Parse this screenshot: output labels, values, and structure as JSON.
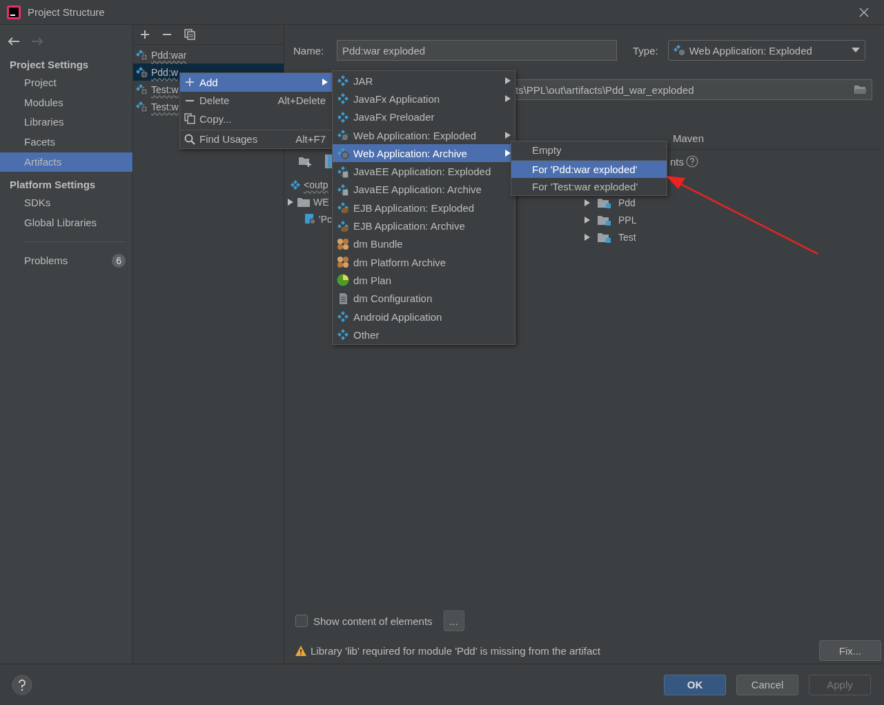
{
  "window": {
    "title": "Project Structure"
  },
  "sidebar": {
    "sections": [
      {
        "title": "Project Settings",
        "items": [
          {
            "label": "Project",
            "selected": false
          },
          {
            "label": "Modules",
            "selected": false
          },
          {
            "label": "Libraries",
            "selected": false
          },
          {
            "label": "Facets",
            "selected": false
          },
          {
            "label": "Artifacts",
            "selected": true
          }
        ]
      },
      {
        "title": "Platform Settings",
        "items": [
          {
            "label": "SDKs",
            "selected": false
          },
          {
            "label": "Global Libraries",
            "selected": false
          }
        ]
      }
    ],
    "problems": {
      "label": "Problems",
      "count": "6"
    }
  },
  "artifacts": [
    {
      "label": "Pdd:war",
      "selected": false
    },
    {
      "label": "Pdd:w",
      "selected": true
    },
    {
      "label": "Test:w",
      "selected": false
    },
    {
      "label": "Test:w",
      "selected": false
    }
  ],
  "editor": {
    "name_label": "Name:",
    "name_value": "Pdd:war exploded",
    "type_label": "Type:",
    "type_value": "Web Application: Exploded",
    "output_path": "ts\\PPL\\out\\artifacts\\Pdd_war_exploded",
    "tab_label": "Maven",
    "available_label": "nts",
    "layout_tree": [
      {
        "label": "<outp",
        "kind": "root"
      },
      {
        "label": "WE",
        "kind": "folder"
      },
      {
        "label": "'Pc",
        "kind": "module"
      }
    ],
    "available_tree": [
      {
        "label": "Pdd",
        "expanded": false
      },
      {
        "label": "PPL",
        "expanded": false
      },
      {
        "label": "Test",
        "expanded": false
      }
    ],
    "show_content": {
      "label": "Show content of elements",
      "checked": false
    },
    "more_button": "...",
    "warning": "Library 'lib' required for module 'Pdd' is missing from the artifact",
    "fix_button": "Fix..."
  },
  "context_menu": [
    {
      "kind": "add",
      "label": "Add",
      "selected": true,
      "submenu": true,
      "separator_before": false
    },
    {
      "kind": "delete",
      "label": "Delete",
      "shortcut": "Alt+Delete",
      "selected": false,
      "submenu": false,
      "separator_before": false
    },
    {
      "kind": "copy",
      "label": "Copy...",
      "selected": false,
      "submenu": false,
      "separator_before": false
    },
    {
      "kind": "find",
      "label": "Find Usages",
      "shortcut": "Alt+F7",
      "selected": false,
      "submenu": false,
      "separator_before": true
    }
  ],
  "add_menu": [
    {
      "kind": "plain",
      "label": "JAR",
      "submenu": true,
      "selected": false
    },
    {
      "kind": "plain",
      "label": "JavaFx Application",
      "submenu": true,
      "selected": false
    },
    {
      "kind": "plain",
      "label": "JavaFx Preloader",
      "submenu": false,
      "selected": false
    },
    {
      "kind": "web",
      "label": "Web Application: Exploded",
      "submenu": true,
      "selected": false
    },
    {
      "kind": "web",
      "label": "Web Application: Archive",
      "submenu": true,
      "selected": true
    },
    {
      "kind": "javaee",
      "label": "JavaEE Application: Exploded",
      "submenu": false,
      "selected": false
    },
    {
      "kind": "javaee",
      "label": "JavaEE Application: Archive",
      "submenu": false,
      "selected": false
    },
    {
      "kind": "ejb",
      "label": "EJB Application: Exploded",
      "submenu": false,
      "selected": false
    },
    {
      "kind": "ejb",
      "label": "EJB Application: Archive",
      "submenu": false,
      "selected": false
    },
    {
      "kind": "bundle",
      "label": "dm Bundle",
      "submenu": false,
      "selected": false
    },
    {
      "kind": "bundle",
      "label": "dm Platform Archive",
      "submenu": false,
      "selected": false
    },
    {
      "kind": "plan",
      "label": "dm Plan",
      "submenu": false,
      "selected": false
    },
    {
      "kind": "config",
      "label": "dm Configuration",
      "submenu": false,
      "selected": false
    },
    {
      "kind": "plain",
      "label": "Android Application",
      "submenu": false,
      "selected": false
    },
    {
      "kind": "plain",
      "label": "Other",
      "submenu": false,
      "selected": false
    }
  ],
  "archive_menu": [
    {
      "label": "Empty",
      "selected": false,
      "separator_before": false
    },
    {
      "label": "For 'Pdd:war exploded'",
      "selected": true,
      "separator_before": true
    },
    {
      "label": "For 'Test:war exploded'",
      "selected": false,
      "separator_before": false
    }
  ],
  "footer": {
    "buttons": [
      {
        "label": "OK",
        "kind": "primary",
        "disabled": false
      },
      {
        "label": "Cancel",
        "kind": "normal",
        "disabled": false
      },
      {
        "label": "Apply",
        "kind": "normal",
        "disabled": true
      }
    ]
  }
}
